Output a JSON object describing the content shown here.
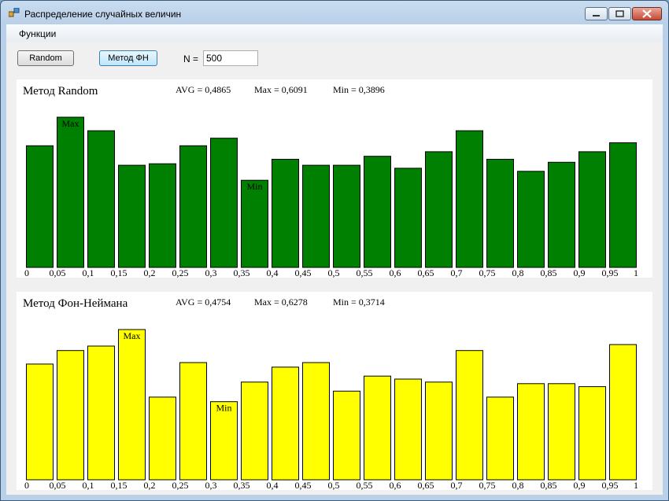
{
  "window": {
    "title": "Распределение случайных величин"
  },
  "menu": {
    "items": [
      "Функции"
    ]
  },
  "toolbar": {
    "random_label": "Random",
    "method_fn_label": "Метод ФН",
    "n_label": "N =",
    "n_value": "500"
  },
  "panels": [
    {
      "title": "Метод Random",
      "avg": "AVG = 0,4865",
      "max": "Max = 0,6091",
      "min": "Min = 0,3896"
    },
    {
      "title": "Метод Фон-Неймана",
      "avg": "AVG = 0,4754",
      "max": "Max = 0,6278",
      "min": "Min = 0,3714"
    }
  ],
  "chart_data": [
    {
      "type": "bar",
      "title": "Метод Random",
      "color": "#008000",
      "x_ticks": [
        "0",
        "0,05",
        "0,1",
        "0,15",
        "0,2",
        "0,25",
        "0,3",
        "0,35",
        "0,4",
        "0,45",
        "0,5",
        "0,55",
        "0,6",
        "0,65",
        "0,7",
        "0,75",
        "0,8",
        "0,85",
        "0,9",
        "0,95",
        "1"
      ],
      "values": [
        0.81,
        1.0,
        0.91,
        0.68,
        0.69,
        0.81,
        0.86,
        0.58,
        0.72,
        0.68,
        0.68,
        0.74,
        0.66,
        0.77,
        0.91,
        0.72,
        0.64,
        0.7,
        0.77,
        0.83
      ],
      "max_label": "Max",
      "max_index": 1,
      "min_label": "Min",
      "min_index": 7
    },
    {
      "type": "bar",
      "title": "Метод Фон-Неймана",
      "color": "#ffff00",
      "x_ticks": [
        "0",
        "0,05",
        "0,1",
        "0,15",
        "0,2",
        "0,25",
        "0,3",
        "0,35",
        "0,4",
        "0,45",
        "0,5",
        "0,55",
        "0,6",
        "0,65",
        "0,7",
        "0,75",
        "0,8",
        "0,85",
        "0,9",
        "0,95",
        "1"
      ],
      "values": [
        0.77,
        0.86,
        0.89,
        1.0,
        0.55,
        0.78,
        0.52,
        0.65,
        0.75,
        0.78,
        0.59,
        0.69,
        0.67,
        0.65,
        0.86,
        0.55,
        0.64,
        0.64,
        0.62,
        0.9
      ],
      "max_label": "Max",
      "max_index": 3,
      "min_label": "Min",
      "min_index": 6
    }
  ]
}
